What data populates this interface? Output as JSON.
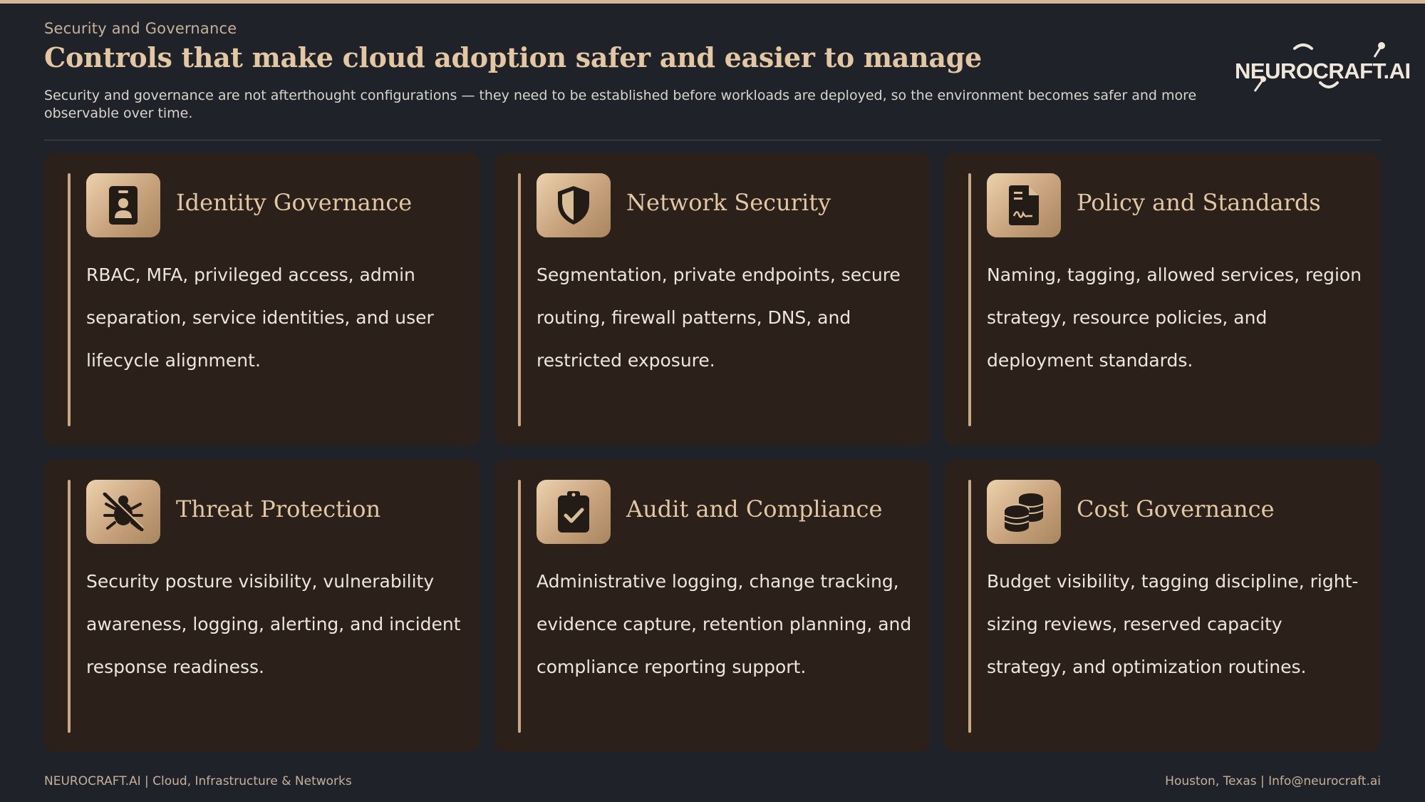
{
  "header": {
    "kicker": "Security and Governance",
    "title": "Controls that make cloud adoption safer and easier to manage",
    "subtitle": "Security and governance are not afterthought configurations — they need to be established before workloads are deployed, so the environment becomes safer and more observable over time."
  },
  "logo": {
    "text": "NEUROCRAFT.AI"
  },
  "cards": [
    {
      "title": "Identity Governance",
      "body": "RBAC, MFA, privileged access, admin separation, service identities, and user lifecycle alignment.",
      "icon": "id-badge-icon"
    },
    {
      "title": "Network Security",
      "body": "Segmentation, private endpoints, secure routing, firewall patterns, DNS, and restricted exposure.",
      "icon": "shield-icon"
    },
    {
      "title": "Policy and Standards",
      "body": "Naming, tagging, allowed services, region strategy, resource policies, and deployment standards.",
      "icon": "signed-document-icon"
    },
    {
      "title": "Threat Protection",
      "body": "Security posture visibility, vulnerability awareness, logging, alerting, and incident response readiness.",
      "icon": "bug-slash-icon"
    },
    {
      "title": "Audit and Compliance",
      "body": "Administrative logging, change tracking, evidence capture, retention planning, and compliance reporting support.",
      "icon": "clipboard-check-icon"
    },
    {
      "title": "Cost Governance",
      "body": "Budget visibility, tagging discipline, right-sizing reviews, reserved capacity strategy, and optimization routines.",
      "icon": "coins-stack-icon"
    }
  ],
  "footer": {
    "left": "NEUROCRAFT.AI | Cloud, Infrastructure & Networks",
    "right": "Houston, Texas | Info@neurocraft.ai"
  },
  "colors": {
    "background": "#1f2329",
    "card": "#2b201a",
    "accent": "#c9a684",
    "title": "#e3c7a2"
  }
}
